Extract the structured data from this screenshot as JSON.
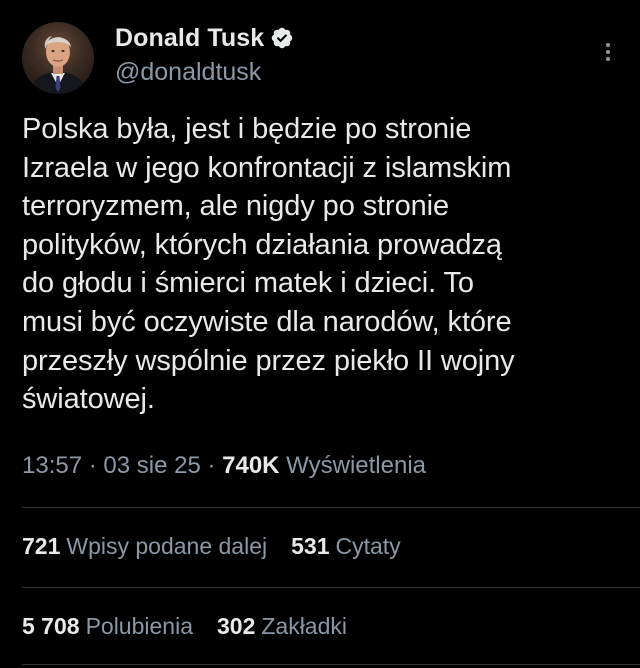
{
  "author": {
    "display_name": "Donald Tusk",
    "handle": "@donaldtusk",
    "verified_icon": "verified-badge-icon",
    "avatar_icon": "profile-photo",
    "more_icon": "more-vertical-icon"
  },
  "tweet": {
    "text": "Polska była, jest i będzie po stronie\nIzraela w jego konfrontacji z islamskim\nterroryzmem, ale nigdy po stronie\npolityków, których działania prowadzą\ndo głodu i śmierci matek i dzieci. To\nmusi być oczywiste dla narodów, które\nprzeszły wspólnie przez piekło II wojny\nświatowej."
  },
  "meta": {
    "time": "13:57",
    "separator": " · ",
    "date": "03 sie 25",
    "views": "740K",
    "views_label": "Wyświetlenia"
  },
  "stats": {
    "reposts_count": "721",
    "reposts_label": "Wpisy podane dalej",
    "quotes_count": "531",
    "quotes_label": "Cytaty",
    "likes_count": "5 708",
    "likes_label": "Polubienia",
    "bookmarks_count": "302",
    "bookmarks_label": "Zakładki"
  },
  "colors": {
    "background": "#000000",
    "text": "#e7e9ea",
    "secondary": "#8b98a5",
    "divider": "#2f3336",
    "verified": "#e7e9ea"
  }
}
